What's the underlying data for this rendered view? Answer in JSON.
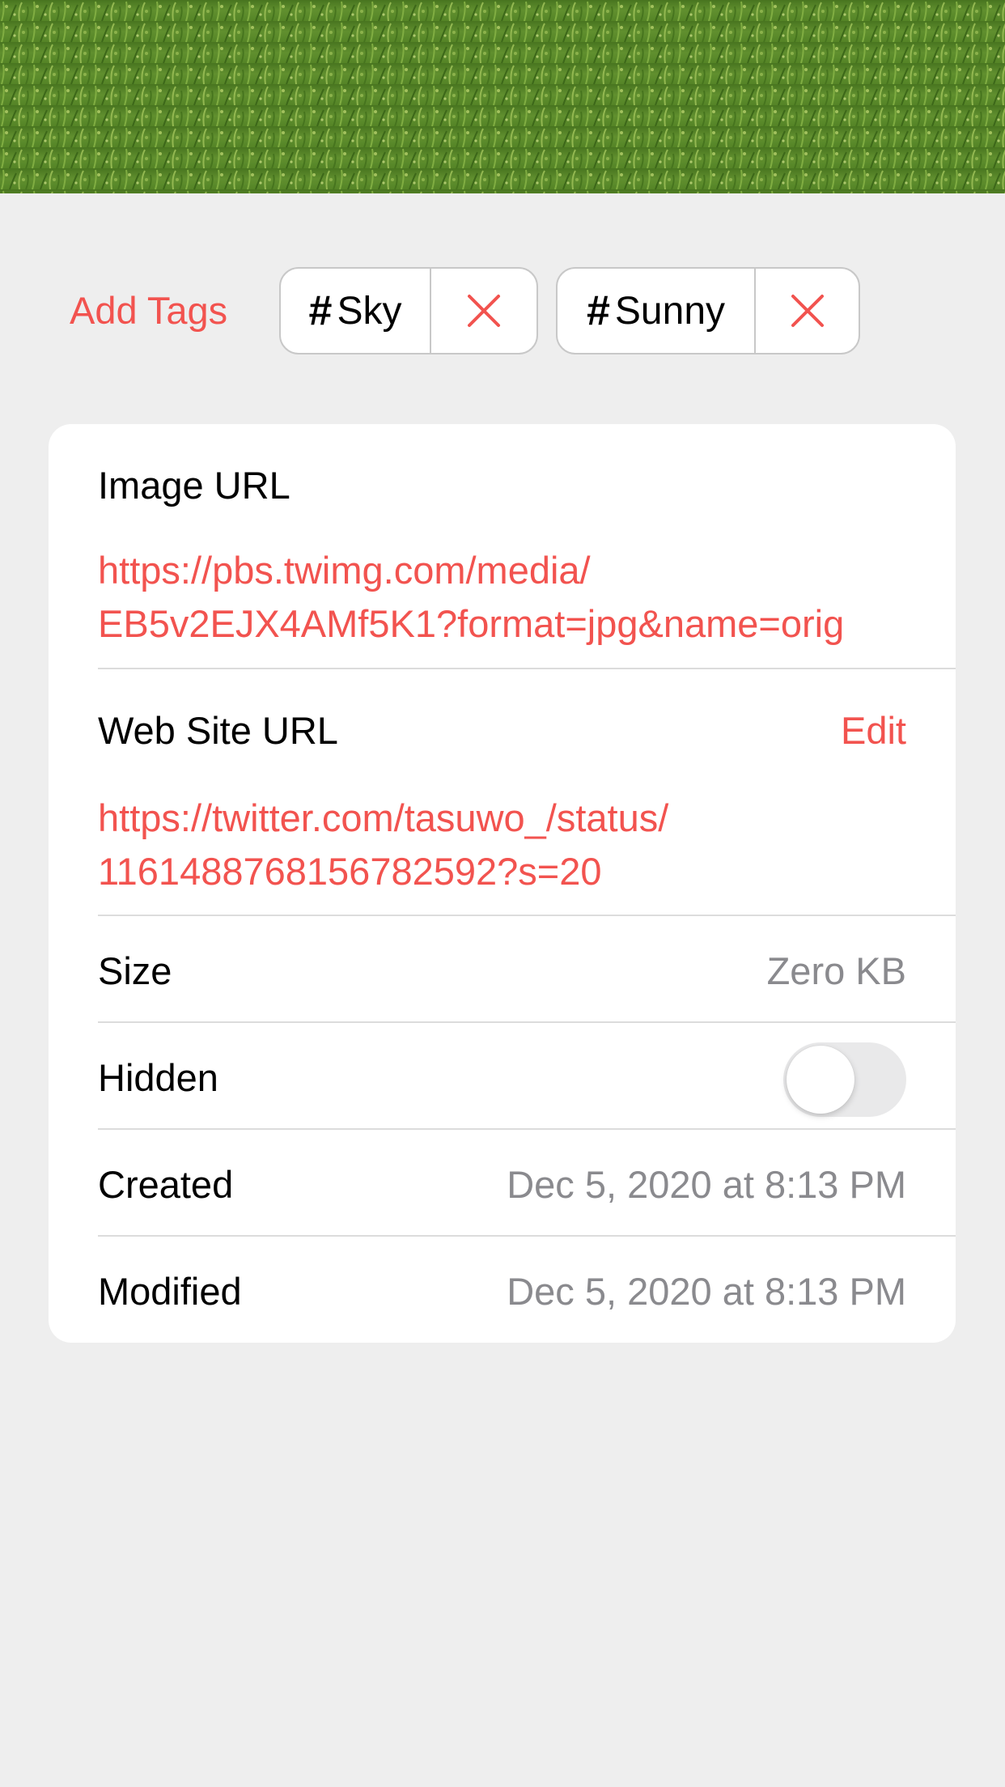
{
  "hero": {
    "description_icon": "rice-field-photo"
  },
  "tags": {
    "add_label": "Add Tags",
    "items": [
      {
        "hash": "#",
        "label": "Sky",
        "remove_icon": "close-icon"
      },
      {
        "hash": "#",
        "label": "Sunny",
        "remove_icon": "close-icon"
      }
    ]
  },
  "details": {
    "image_url": {
      "label": "Image URL",
      "line1": "https://pbs.twimg.com/media/",
      "line2": "EB5v2EJX4AMf5K1?format=jpg&name=orig"
    },
    "web_site_url": {
      "label": "Web Site URL",
      "edit_label": "Edit",
      "line1": "https://twitter.com/tasuwo_/status/",
      "line2": "1161488768156782592?s=20"
    },
    "size": {
      "label": "Size",
      "value": "Zero KB"
    },
    "hidden": {
      "label": "Hidden",
      "on": false
    },
    "created": {
      "label": "Created",
      "value": "Dec 5, 2020 at 8:13 PM"
    },
    "modified": {
      "label": "Modified",
      "value": "Dec 5, 2020 at 8:13 PM"
    }
  },
  "colors": {
    "accent": "#f2534f",
    "background": "#eeeeee",
    "secondary_text": "#8a8a8e"
  }
}
